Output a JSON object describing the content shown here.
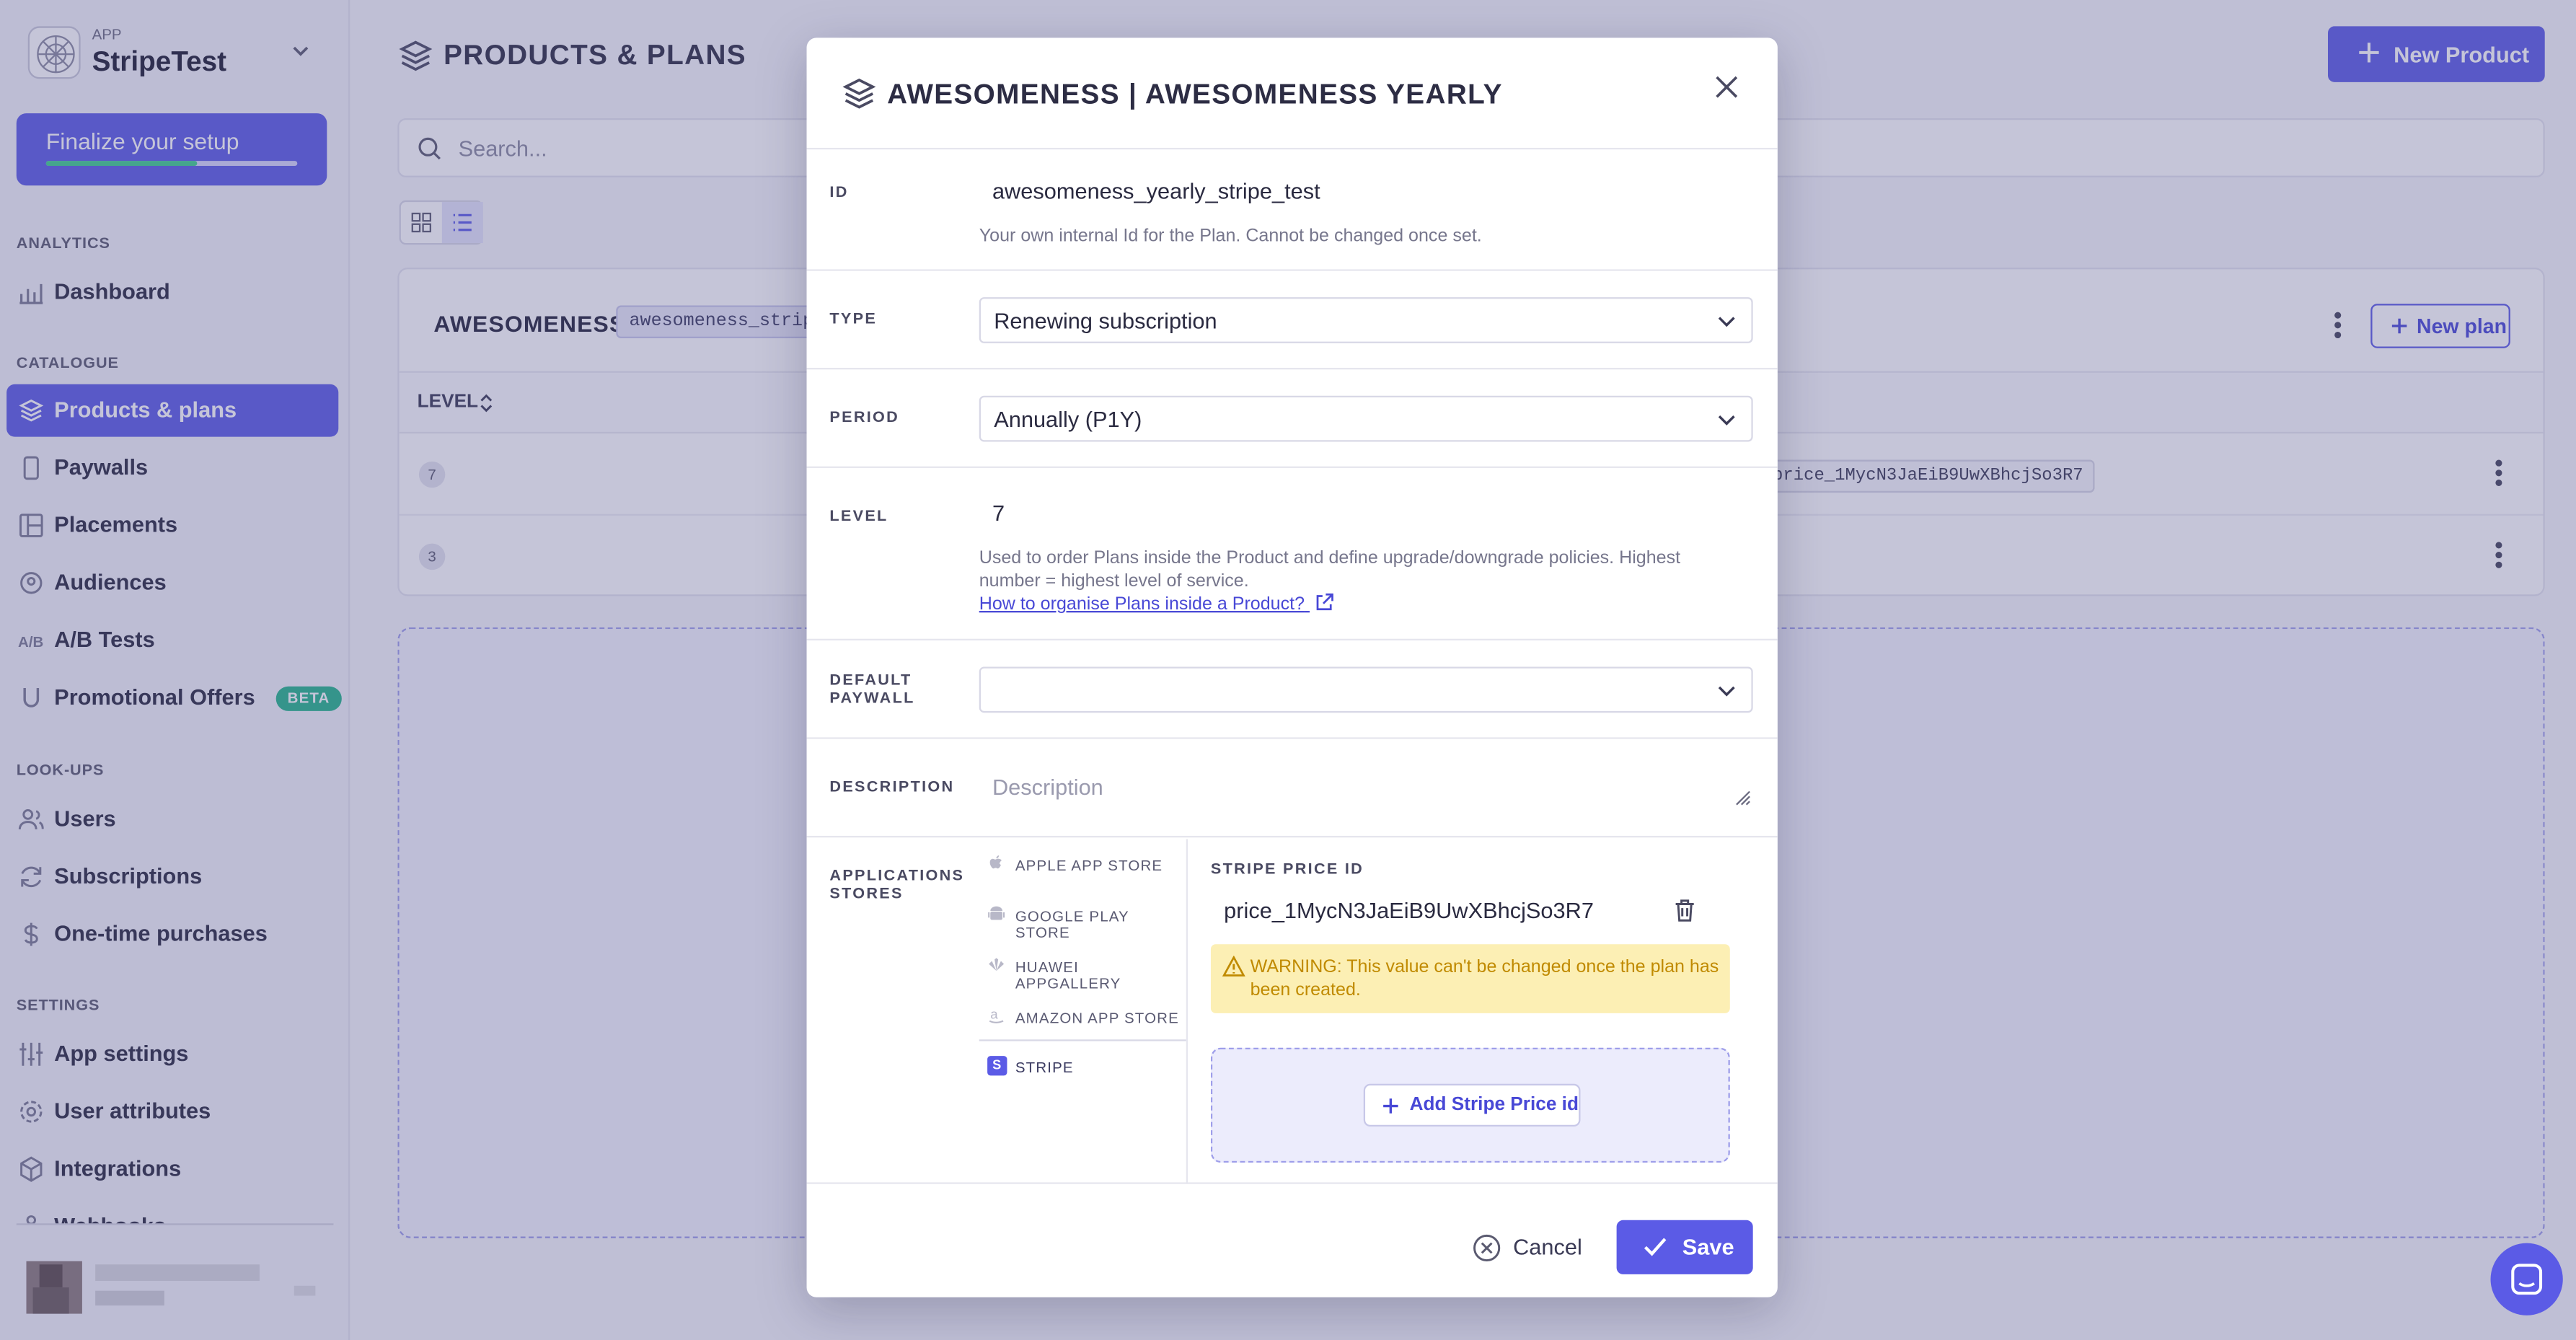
{
  "app": {
    "label": "APP",
    "name": "StripeTest"
  },
  "setup": {
    "label": "Finalize your setup",
    "progress": 0.6
  },
  "sidebar": {
    "sections": [
      {
        "title": "ANALYTICS",
        "items": [
          {
            "label": "Dashboard",
            "icon": "chart-icon"
          }
        ]
      },
      {
        "title": "CATALOGUE",
        "items": [
          {
            "label": "Products & plans",
            "icon": "layers-icon",
            "active": true
          },
          {
            "label": "Paywalls",
            "icon": "phone-icon"
          },
          {
            "label": "Placements",
            "icon": "layout-icon"
          },
          {
            "label": "Audiences",
            "icon": "audience-icon"
          },
          {
            "label": "A/B Tests",
            "icon": "ab-icon"
          },
          {
            "label": "Promotional Offers",
            "icon": "magnet-icon",
            "badge": "BETA"
          }
        ]
      },
      {
        "title": "LOOK-UPS",
        "items": [
          {
            "label": "Users",
            "icon": "users-icon"
          },
          {
            "label": "Subscriptions",
            "icon": "refresh-icon"
          },
          {
            "label": "One-time purchases",
            "icon": "dollar-icon"
          }
        ]
      },
      {
        "title": "SETTINGS",
        "items": [
          {
            "label": "App settings",
            "icon": "sliders-icon"
          },
          {
            "label": "User attributes",
            "icon": "gear-icon"
          },
          {
            "label": "Integrations",
            "icon": "cube-icon"
          },
          {
            "label": "Webhooks",
            "icon": "webhook-icon"
          }
        ]
      }
    ]
  },
  "page": {
    "title": "PRODUCTS & PLANS",
    "new_product": "New Product",
    "search_placeholder": "Search...",
    "product": {
      "name": "AWESOMENESS",
      "code": "awesomeness_stripe_test",
      "new_plan": "New plan"
    },
    "table": {
      "level_header": "LEVEL",
      "rows": [
        {
          "level": "7",
          "price_id": "price_1MycN3JaEiB9UwXBhcjSo3R7"
        },
        {
          "level": "3",
          "price_id": ""
        }
      ]
    }
  },
  "modal": {
    "title": "AWESOMENESS | AWESOMENESS YEARLY",
    "id": {
      "label": "ID",
      "value": "awesomeness_yearly_stripe_test",
      "hint": "Your own internal Id for the Plan. Cannot be changed once set."
    },
    "type": {
      "label": "TYPE",
      "value": "Renewing subscription"
    },
    "period": {
      "label": "PERIOD",
      "value": "Annually (P1Y)"
    },
    "level": {
      "label": "LEVEL",
      "value": "7",
      "hint": "Used to order Plans inside the Product and define upgrade/downgrade policies. Highest number = highest level of service.",
      "link": "How to organise Plans inside a Product?"
    },
    "default_paywall": {
      "label_1": "DEFAULT",
      "label_2": "PAYWALL",
      "value": ""
    },
    "description": {
      "label": "DESCRIPTION",
      "placeholder": "Description"
    },
    "stores": {
      "label_1": "APPLICATIONS",
      "label_2": "STORES",
      "items": [
        {
          "label": "APPLE APP STORE",
          "icon": "apple-icon"
        },
        {
          "label": "GOOGLE PLAY STORE",
          "icon": "android-icon"
        },
        {
          "label": "HUAWEI APPGALLERY",
          "icon": "huawei-icon"
        },
        {
          "label": "AMAZON APP STORE",
          "icon": "amazon-icon"
        },
        {
          "label": "STRIPE",
          "icon": "stripe-icon",
          "selected": true
        }
      ]
    },
    "stripe": {
      "price_label": "STRIPE PRICE ID",
      "price_value": "price_1MycN3JaEiB9UwXBhcjSo3R7",
      "warning": "WARNING: This value can't be changed once the plan has been created.",
      "add_button": "Add Stripe Price id"
    },
    "cancel": "Cancel",
    "save": "Save"
  },
  "colors": {
    "accent": "#5b5be6",
    "beta": "#25b58a",
    "warning_bg": "#fcefb4",
    "warning_text": "#c08a00"
  }
}
